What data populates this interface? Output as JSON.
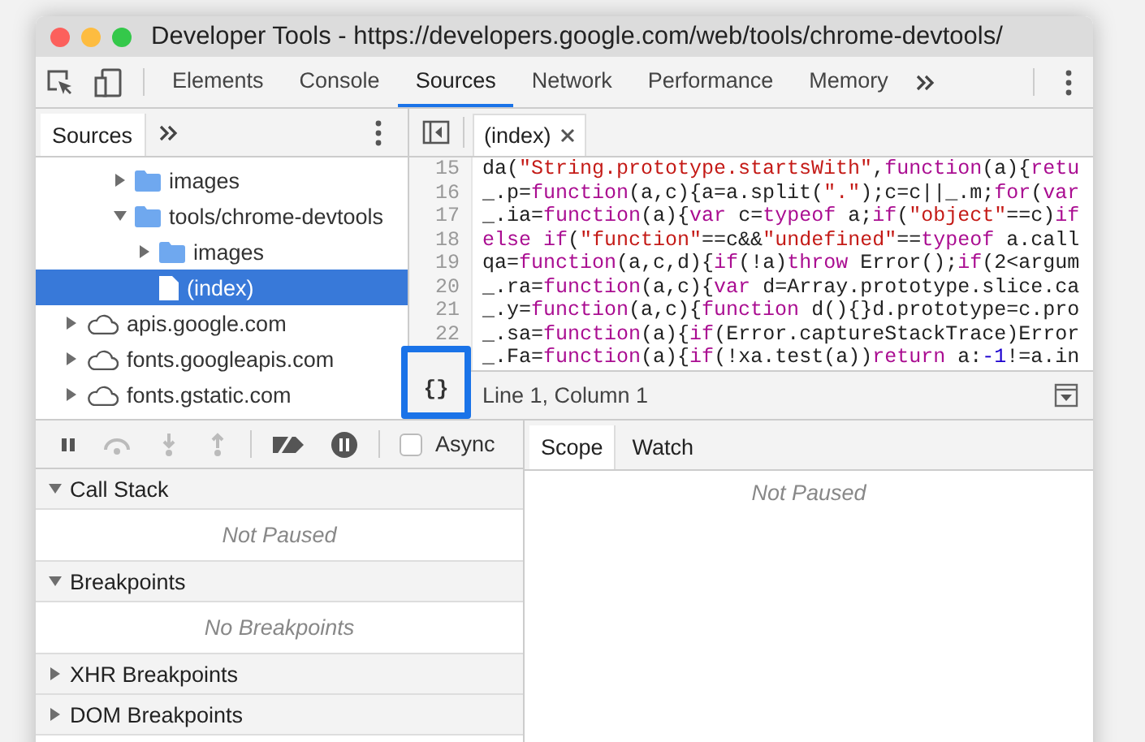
{
  "window": {
    "title": "Developer Tools - https://developers.google.com/web/tools/chrome-devtools/"
  },
  "panel_tabs": [
    {
      "label": "Elements",
      "selected": false
    },
    {
      "label": "Console",
      "selected": false
    },
    {
      "label": "Sources",
      "selected": true
    },
    {
      "label": "Network",
      "selected": false
    },
    {
      "label": "Performance",
      "selected": false
    },
    {
      "label": "Memory",
      "selected": false
    }
  ],
  "sidebar": {
    "tabs": [
      {
        "label": "Sources",
        "selected": true
      }
    ],
    "tree": [
      {
        "children": [
          {
            "children": [
              {
                "kind": "folder",
                "label": "images",
                "expanded": false
              },
              {
                "kind": "folder",
                "label": "tools/chrome-devtools",
                "expanded": true,
                "children": [
                  {
                    "kind": "folder",
                    "label": "images",
                    "expanded": false
                  },
                  {
                    "kind": "file",
                    "label": "(index)",
                    "selected": true
                  }
                ]
              }
            ]
          }
        ]
      },
      {
        "kind": "domain",
        "label": "apis.google.com",
        "expanded": false
      },
      {
        "kind": "domain",
        "label": "fonts.googleapis.com",
        "expanded": false
      },
      {
        "kind": "domain",
        "label": "fonts.gstatic.com",
        "expanded": false
      }
    ]
  },
  "editor": {
    "tabs": [
      {
        "label": "(index)",
        "selected": true
      }
    ],
    "lines": [
      {
        "number": "15",
        "tokens": [
          {
            "kind": "plain",
            "text": "da("
          },
          {
            "kind": "string",
            "text": "\"String.prototype.startsWith\""
          },
          {
            "kind": "plain",
            "text": ","
          },
          {
            "kind": "keyword",
            "text": "function"
          },
          {
            "kind": "plain",
            "text": "(a){"
          },
          {
            "kind": "keyword",
            "text": "retu"
          }
        ]
      },
      {
        "number": "16",
        "tokens": [
          {
            "kind": "plain",
            "text": "_.p="
          },
          {
            "kind": "keyword",
            "text": "function"
          },
          {
            "kind": "plain",
            "text": "(a,c){a=a.split("
          },
          {
            "kind": "string",
            "text": "\".\""
          },
          {
            "kind": "plain",
            "text": ");c=c||_.m;"
          },
          {
            "kind": "keyword",
            "text": "for"
          },
          {
            "kind": "plain",
            "text": "("
          },
          {
            "kind": "keyword",
            "text": "var"
          }
        ]
      },
      {
        "number": "17",
        "tokens": [
          {
            "kind": "plain",
            "text": "_.ia="
          },
          {
            "kind": "keyword",
            "text": "function"
          },
          {
            "kind": "plain",
            "text": "(a){"
          },
          {
            "kind": "keyword",
            "text": "var"
          },
          {
            "kind": "plain",
            "text": " c="
          },
          {
            "kind": "keyword",
            "text": "typeof"
          },
          {
            "kind": "plain",
            "text": " a;"
          },
          {
            "kind": "keyword",
            "text": "if"
          },
          {
            "kind": "plain",
            "text": "("
          },
          {
            "kind": "string",
            "text": "\"object\""
          },
          {
            "kind": "plain",
            "text": "==c)"
          },
          {
            "kind": "keyword",
            "text": "if"
          }
        ]
      },
      {
        "number": "18",
        "tokens": [
          {
            "kind": "keyword",
            "text": "else if"
          },
          {
            "kind": "plain",
            "text": "("
          },
          {
            "kind": "string",
            "text": "\"function\""
          },
          {
            "kind": "plain",
            "text": "==c&&"
          },
          {
            "kind": "string",
            "text": "\"undefined\""
          },
          {
            "kind": "plain",
            "text": "=="
          },
          {
            "kind": "keyword",
            "text": "typeof"
          },
          {
            "kind": "plain",
            "text": " a.call"
          }
        ]
      },
      {
        "number": "19",
        "tokens": [
          {
            "kind": "plain",
            "text": "qa="
          },
          {
            "kind": "keyword",
            "text": "function"
          },
          {
            "kind": "plain",
            "text": "(a,c,d){"
          },
          {
            "kind": "keyword",
            "text": "if"
          },
          {
            "kind": "plain",
            "text": "(!a)"
          },
          {
            "kind": "keyword",
            "text": "throw"
          },
          {
            "kind": "plain",
            "text": " Error();"
          },
          {
            "kind": "keyword",
            "text": "if"
          },
          {
            "kind": "plain",
            "text": "(2<argum"
          }
        ]
      },
      {
        "number": "20",
        "tokens": [
          {
            "kind": "plain",
            "text": "_.ra="
          },
          {
            "kind": "keyword",
            "text": "function"
          },
          {
            "kind": "plain",
            "text": "(a,c){"
          },
          {
            "kind": "keyword",
            "text": "var"
          },
          {
            "kind": "plain",
            "text": " d=Array.prototype.slice.ca"
          }
        ]
      },
      {
        "number": "21",
        "tokens": [
          {
            "kind": "plain",
            "text": "_.y="
          },
          {
            "kind": "keyword",
            "text": "function"
          },
          {
            "kind": "plain",
            "text": "(a,c){"
          },
          {
            "kind": "keyword",
            "text": "function"
          },
          {
            "kind": "plain",
            "text": " d(){}d.prototype=c.pro"
          }
        ]
      },
      {
        "number": "22",
        "tokens": [
          {
            "kind": "plain",
            "text": "_.sa="
          },
          {
            "kind": "keyword",
            "text": "function"
          },
          {
            "kind": "plain",
            "text": "(a){"
          },
          {
            "kind": "keyword",
            "text": "if"
          },
          {
            "kind": "plain",
            "text": "(Error.captureStackTrace)Error"
          }
        ]
      },
      {
        "tokens": [
          {
            "kind": "plain",
            "text": "_.Fa="
          },
          {
            "kind": "keyword",
            "text": "function"
          },
          {
            "kind": "plain",
            "text": "(a){"
          },
          {
            "kind": "keyword",
            "text": "if"
          },
          {
            "kind": "plain",
            "text": "(!xa.test(a))"
          },
          {
            "kind": "keyword",
            "text": "return"
          },
          {
            "kind": "plain",
            "text": " a:"
          },
          {
            "kind": "number",
            "text": "-1"
          },
          {
            "kind": "plain",
            "text": "!=a.in"
          }
        ]
      }
    ],
    "format_button": "{}",
    "status": "Line 1, Column 1"
  },
  "debugger": {
    "async": {
      "label": "Async",
      "checked": false
    },
    "sections": [
      {
        "title": "Call Stack",
        "expanded": true,
        "message": "Not Paused"
      },
      {
        "title": "Breakpoints",
        "expanded": true,
        "message": "No Breakpoints"
      },
      {
        "title": "XHR Breakpoints",
        "expanded": false
      },
      {
        "title": "DOM Breakpoints",
        "expanded": false
      }
    ],
    "side_tabs": [
      {
        "label": "Scope",
        "selected": true
      },
      {
        "label": "Watch",
        "selected": false
      }
    ],
    "side_message": "Not Paused"
  }
}
